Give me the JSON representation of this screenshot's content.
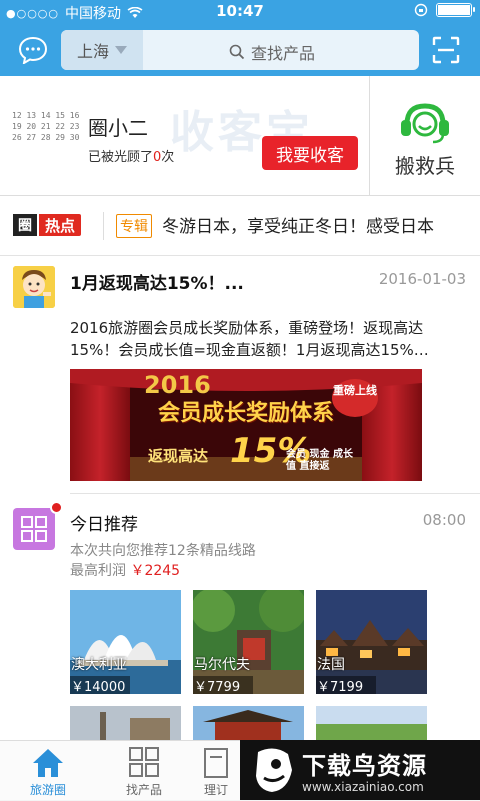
{
  "status_bar": {
    "carrier": "中国移动",
    "time": "10:47",
    "battery_level": 1.0
  },
  "nav": {
    "city": "上海",
    "search_placeholder": "查找产品"
  },
  "profile": {
    "watermark": "收客宝",
    "name": "圈小二",
    "visited_prefix": "已被光顾了",
    "visited_count": "0",
    "visited_suffix": "次",
    "collect_button": "我要收客",
    "helper_label": "搬救兵",
    "calendar_rows": [
      "12 13 14 15 16",
      "19 20 21 22 23",
      "26 27 28 29 30"
    ]
  },
  "newsbar": {
    "logo_box": "圈",
    "logo_text": "热点",
    "tag": "专辑",
    "headline": "冬游日本，享受纯正冬日！感受日本"
  },
  "post1": {
    "title": "1月返现高达15%！...",
    "date": "2016-01-03",
    "body": "2016旅游圈会员成长奖励体系，重磅登场！返现高达15%！会员成长值=现金直返额！1月返现高达15%…",
    "banner": {
      "year": "2016",
      "headline": "会员成长奖励体系",
      "cashback": "返现高达",
      "percent": "15%",
      "badge": "重磅上线",
      "sub": "会员 现金 成长值 直接返"
    }
  },
  "post2": {
    "title": "今日推荐",
    "time": "08:00",
    "subtitle": "本次共向您推荐12条精品线路",
    "profit_label": "最高利润",
    "profit_amount": "￥2245",
    "tiles": [
      {
        "label": "澳大利亚",
        "price": "￥14000"
      },
      {
        "label": "马尔代夫",
        "price": "￥7799"
      },
      {
        "label": "法国",
        "price": "￥7199"
      }
    ]
  },
  "tabbar": {
    "tabs": [
      {
        "label": "旅游圈"
      },
      {
        "label": "找产品"
      },
      {
        "label": "理订"
      }
    ]
  },
  "promo": {
    "title": "下载鸟资源",
    "url": "www.xiazainiao.com"
  },
  "colors": {
    "brand_blue": "#3aa3e3",
    "red": "#e8232a",
    "orange": "#f08a00",
    "active_tab": "#2a8fd8"
  }
}
